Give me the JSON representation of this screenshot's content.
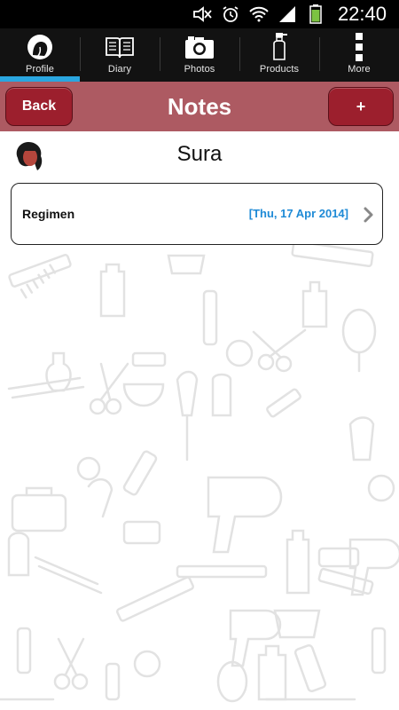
{
  "status_bar": {
    "time": "22:40",
    "icons": [
      "mute-icon",
      "alarm-icon",
      "wifi-icon",
      "signal-icon",
      "battery-icon"
    ]
  },
  "tabs": [
    {
      "label": "Profile",
      "icon": "profile-icon",
      "active": true
    },
    {
      "label": "Diary",
      "icon": "book-icon",
      "active": false
    },
    {
      "label": "Photos",
      "icon": "camera-icon",
      "active": false
    },
    {
      "label": "Products",
      "icon": "spray-bottle-icon",
      "active": false
    },
    {
      "label": "More",
      "icon": "more-vertical-icon",
      "active": false
    }
  ],
  "header": {
    "title": "Notes",
    "back_label": "Back",
    "add_label": "+"
  },
  "profile": {
    "name": "Sura"
  },
  "notes": [
    {
      "label": "Regimen",
      "date": "[Thu, 17 Apr 2014]"
    }
  ],
  "colors": {
    "status_bar": "#000000",
    "tab_bar": "#121212",
    "tab_active_indicator": "#2aa6e0",
    "header_bg": "#ad5a62",
    "button_bg": "#9c1f2d",
    "date_text": "#1e8ad6"
  }
}
